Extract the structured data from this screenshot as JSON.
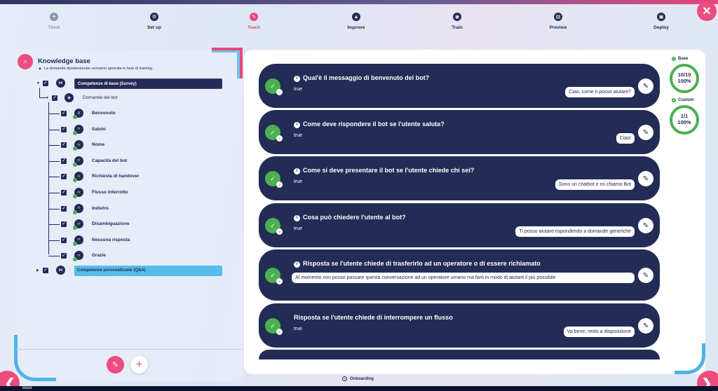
{
  "stepper": [
    {
      "label": "Think",
      "state": "muted",
      "icon": "lightbulb-icon",
      "glyph": "✦"
    },
    {
      "label": "Set up",
      "state": "done",
      "icon": "gear-icon",
      "glyph": "⚙"
    },
    {
      "label": "Teach",
      "state": "active",
      "icon": "pencil-icon",
      "glyph": "✎"
    },
    {
      "label": "Improve",
      "state": "done",
      "icon": "flask-icon",
      "glyph": "▲"
    },
    {
      "label": "Train",
      "state": "done",
      "icon": "brain-icon",
      "glyph": "◉"
    },
    {
      "label": "Preview",
      "state": "done",
      "icon": "chat-icon",
      "glyph": "▤"
    },
    {
      "label": "Deploy",
      "state": "done",
      "icon": "rocket-icon",
      "glyph": "▣"
    }
  ],
  "knowledge_base": {
    "title": "Knowledge base",
    "warning": "Le domande deselezionate verranno ignorate in fase di training.",
    "group_survey": "Competenze di base (Survey)",
    "subgroup": "Domande del bot",
    "items": [
      "Benvenuto",
      "Saluto",
      "Nome",
      "Capacità del bot",
      "Richiesta di handover",
      "Flusso interrotto",
      "Indietro",
      "Disambiguazione",
      "Nessuna risposta",
      "Grazie"
    ],
    "group_custom": "Competenze personalizzate (Q&A)"
  },
  "cards": [
    {
      "question": "Qual'è il messaggio di benvenuto del bot?",
      "flag": "true",
      "answer": "Ciao, come ti posso aiutare?",
      "info": true
    },
    {
      "question": "Come deve rispondere il bot se l'utente saluta?",
      "flag": "true",
      "answer": "Ciao!",
      "info": true
    },
    {
      "question": "Come si deve presentare il bot se l'utente chiede chi sei?",
      "flag": "true",
      "answer": "Sono un chatbot e mi chiamo Bot",
      "info": true
    },
    {
      "question": "Cosa può chiedere l'utente al bot?",
      "flag": "true",
      "answer": "Ti posso aiutare rispondendo a domande generiche",
      "info": true
    },
    {
      "question": "Risposta se l'utente chiede di trasferirlo ad un operatore o di essere richiamato",
      "flag": "true",
      "answer": "Al momento non posso passare questa conversazione ad un operatore umano ma farò in modo di aiutarti il più possibile",
      "info": true
    },
    {
      "question": "Risposta se l'utente chiede di interrompere un flusso",
      "flag": "true",
      "answer": "Va bene, resto a disposizione",
      "info": false
    }
  ],
  "gauges": {
    "base": {
      "label": "Base",
      "value": "10/10",
      "percent": "100%"
    },
    "custom": {
      "label": "Custom",
      "value": "1/1",
      "percent": "100%"
    }
  },
  "footer": {
    "onboarding": "Onboarding",
    "bottom_text": "Base"
  },
  "colors": {
    "navy": "#232c55",
    "pink": "#ec4c7f",
    "green": "#4caf50",
    "cyan": "#56bde9"
  }
}
